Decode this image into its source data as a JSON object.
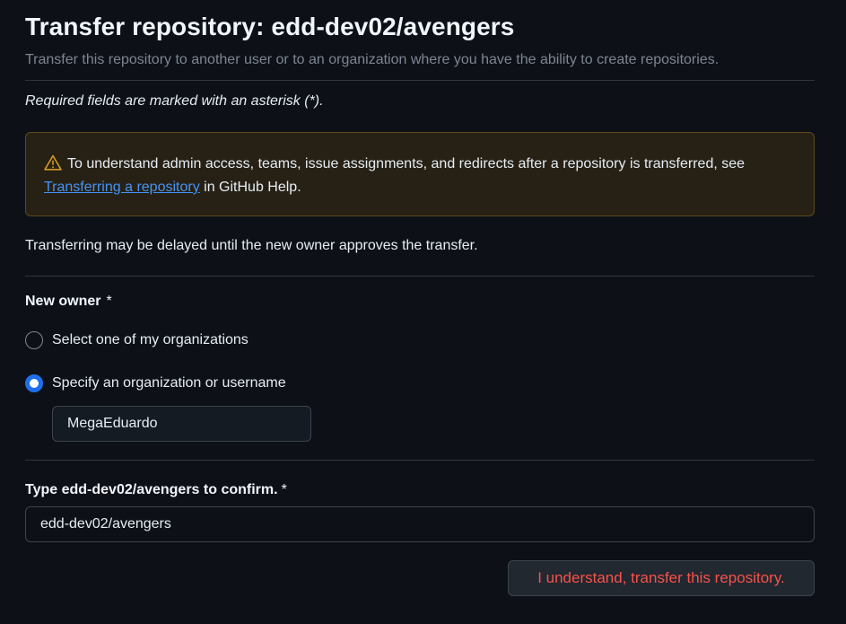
{
  "header": {
    "title": "Transfer repository: edd-dev02/avengers",
    "subtitle": "Transfer this repository to another user or to an organization where you have the ability to create repositories."
  },
  "required_note": "Required fields are marked with an asterisk (*).",
  "flash": {
    "icon": "alert-icon",
    "text_before": "To understand admin access, teams, issue assignments, and redirects after a repository is transferred, see ",
    "link_text": "Transferring a repository",
    "text_after": " in GitHub Help."
  },
  "delay_note": "Transferring may be delayed until the new owner approves the transfer.",
  "new_owner": {
    "label": "New owner",
    "required_mark": "*",
    "options": [
      {
        "label": "Select one of my organizations",
        "checked": false
      },
      {
        "label": "Specify an organization or username",
        "checked": true
      }
    ],
    "username_value": "MegaEduardo"
  },
  "confirm": {
    "label": "Type edd-dev02/avengers to confirm.",
    "required_mark": "*",
    "value": "edd-dev02/avengers"
  },
  "submit_button": {
    "label": "I understand, transfer this repository."
  },
  "colors": {
    "background": "#0d1117",
    "danger": "#f85149",
    "link": "#4493f8",
    "accent": "#1f6feb",
    "warning_bg": "#272115"
  }
}
